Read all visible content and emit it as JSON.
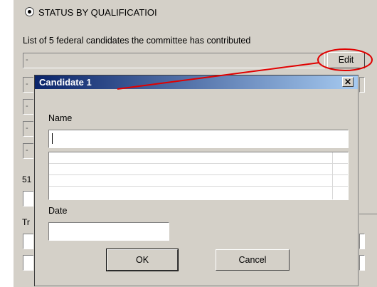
{
  "section": {
    "radio_label": "STATUS BY QUALIFICATIOI",
    "list_label": "List of 5 federal candidates the committee has contributed",
    "edit_label": "Edit",
    "row_placeholder": "-",
    "bg_label_51": "51",
    "bg_label_tr": "Tr"
  },
  "dialog": {
    "title": "Candidate 1",
    "close_glyph": "✕",
    "name_label": "Name",
    "name_value": "",
    "date_label": "Date",
    "date_value": "",
    "ok_label": "OK",
    "cancel_label": "Cancel"
  },
  "colors": {
    "annotation": "#e00000",
    "titlebar_start": "#0a246a",
    "titlebar_end": "#a6caf0",
    "panel": "#d4d0c8"
  }
}
